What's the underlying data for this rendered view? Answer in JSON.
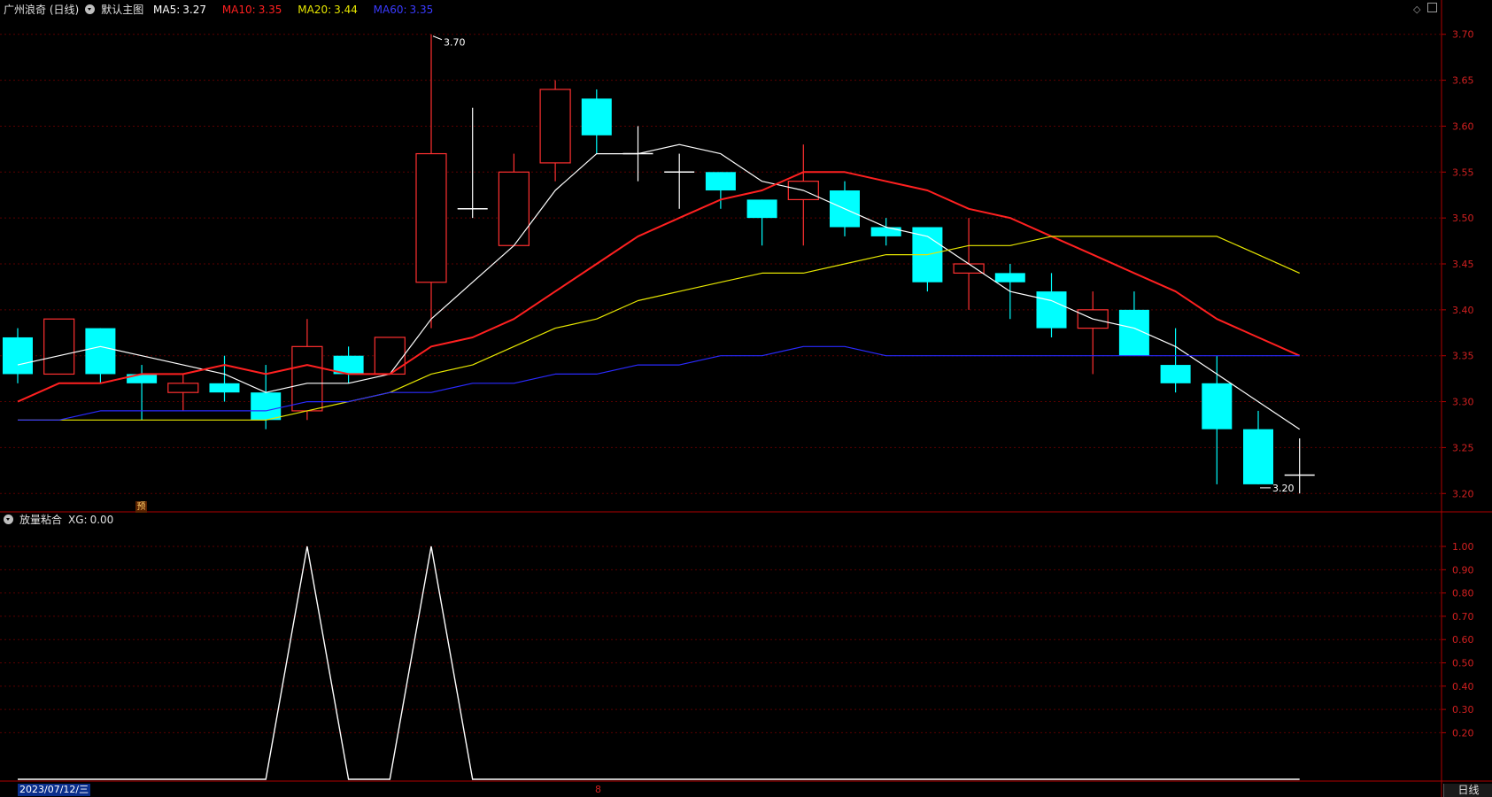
{
  "header": {
    "stock_name": "广州浪奇 (日线)",
    "main_chart_label": "默认主图",
    "ma5": {
      "label": "MA5:",
      "value": "3.27",
      "color": "#ffffff"
    },
    "ma10": {
      "label": "MA10:",
      "value": "3.35",
      "color": "#ff2020"
    },
    "ma20": {
      "label": "MA20:",
      "value": "3.44",
      "color": "#e6e600"
    },
    "ma60": {
      "label": "MA60:",
      "value": "3.35",
      "color": "#2a2aff"
    }
  },
  "indicator_header": {
    "name": "放量粘合",
    "xg_label": "XG:",
    "xg_value": "0.00"
  },
  "footer": {
    "date": "2023/07/12/三",
    "month_marker": "8",
    "period_tab": "日线"
  },
  "badge": {
    "text": "预"
  },
  "annotations": {
    "high": "3.70",
    "low": "3.20"
  },
  "colors": {
    "up": "#ff3030",
    "down": "#00ffff",
    "grid": "#5a0000",
    "axis": "#b00000",
    "axis_text": "#d02020"
  },
  "chart_data": [
    {
      "type": "candlestick",
      "ylim": [
        3.18,
        3.72
      ],
      "y_ticks": [
        "3.20",
        "3.25",
        "3.30",
        "3.35",
        "3.40",
        "3.45",
        "3.50",
        "3.55",
        "3.60",
        "3.65",
        "3.70"
      ],
      "grid": true,
      "candles": [
        {
          "o": 3.37,
          "h": 3.38,
          "l": 3.32,
          "c": 3.33
        },
        {
          "o": 3.33,
          "h": 3.39,
          "l": 3.33,
          "c": 3.39
        },
        {
          "o": 3.38,
          "h": 3.38,
          "l": 3.32,
          "c": 3.33
        },
        {
          "o": 3.33,
          "h": 3.34,
          "l": 3.28,
          "c": 3.32
        },
        {
          "o": 3.31,
          "h": 3.33,
          "l": 3.29,
          "c": 3.32
        },
        {
          "o": 3.32,
          "h": 3.35,
          "l": 3.3,
          "c": 3.31
        },
        {
          "o": 3.31,
          "h": 3.34,
          "l": 3.27,
          "c": 3.28
        },
        {
          "o": 3.29,
          "h": 3.39,
          "l": 3.28,
          "c": 3.36
        },
        {
          "o": 3.35,
          "h": 3.36,
          "l": 3.32,
          "c": 3.33
        },
        {
          "o": 3.33,
          "h": 3.37,
          "l": 3.33,
          "c": 3.37
        },
        {
          "o": 3.43,
          "h": 3.7,
          "l": 3.38,
          "c": 3.57
        },
        {
          "o": 3.51,
          "h": 3.62,
          "l": 3.5,
          "c": 3.51
        },
        {
          "o": 3.47,
          "h": 3.57,
          "l": 3.47,
          "c": 3.55
        },
        {
          "o": 3.56,
          "h": 3.65,
          "l": 3.54,
          "c": 3.64
        },
        {
          "o": 3.63,
          "h": 3.64,
          "l": 3.57,
          "c": 3.59
        },
        {
          "o": 3.57,
          "h": 3.6,
          "l": 3.54,
          "c": 3.57
        },
        {
          "o": 3.55,
          "h": 3.57,
          "l": 3.51,
          "c": 3.55
        },
        {
          "o": 3.55,
          "h": 3.55,
          "l": 3.51,
          "c": 3.53
        },
        {
          "o": 3.52,
          "h": 3.52,
          "l": 3.47,
          "c": 3.5
        },
        {
          "o": 3.52,
          "h": 3.58,
          "l": 3.47,
          "c": 3.54
        },
        {
          "o": 3.53,
          "h": 3.54,
          "l": 3.48,
          "c": 3.49
        },
        {
          "o": 3.49,
          "h": 3.5,
          "l": 3.47,
          "c": 3.48
        },
        {
          "o": 3.49,
          "h": 3.49,
          "l": 3.42,
          "c": 3.43
        },
        {
          "o": 3.44,
          "h": 3.5,
          "l": 3.4,
          "c": 3.45
        },
        {
          "o": 3.44,
          "h": 3.45,
          "l": 3.39,
          "c": 3.43
        },
        {
          "o": 3.42,
          "h": 3.44,
          "l": 3.37,
          "c": 3.38
        },
        {
          "o": 3.38,
          "h": 3.42,
          "l": 3.33,
          "c": 3.4
        },
        {
          "o": 3.4,
          "h": 3.42,
          "l": 3.35,
          "c": 3.35
        },
        {
          "o": 3.34,
          "h": 3.38,
          "l": 3.31,
          "c": 3.32
        },
        {
          "o": 3.32,
          "h": 3.35,
          "l": 3.21,
          "c": 3.27
        },
        {
          "o": 3.27,
          "h": 3.29,
          "l": 3.21,
          "c": 3.21
        },
        {
          "o": 3.22,
          "h": 3.26,
          "l": 3.2,
          "c": 3.22
        }
      ],
      "series": [
        {
          "name": "MA5",
          "color": "#ffffff",
          "values": [
            3.34,
            3.35,
            3.36,
            3.35,
            3.34,
            3.33,
            3.31,
            3.32,
            3.32,
            3.33,
            3.39,
            3.43,
            3.47,
            3.53,
            3.57,
            3.57,
            3.58,
            3.57,
            3.54,
            3.53,
            3.51,
            3.49,
            3.48,
            3.45,
            3.42,
            3.41,
            3.39,
            3.38,
            3.36,
            3.33,
            3.3,
            3.27
          ]
        },
        {
          "name": "MA10",
          "color": "#ff2020",
          "values": [
            3.3,
            3.32,
            3.32,
            3.33,
            3.33,
            3.34,
            3.33,
            3.34,
            3.33,
            3.33,
            3.36,
            3.37,
            3.39,
            3.42,
            3.45,
            3.48,
            3.5,
            3.52,
            3.53,
            3.55,
            3.55,
            3.54,
            3.53,
            3.51,
            3.5,
            3.48,
            3.46,
            3.44,
            3.42,
            3.39,
            3.37,
            3.35
          ]
        },
        {
          "name": "MA20",
          "color": "#e6e600",
          "values": [
            3.28,
            3.28,
            3.28,
            3.28,
            3.28,
            3.28,
            3.28,
            3.29,
            3.3,
            3.31,
            3.33,
            3.34,
            3.36,
            3.38,
            3.39,
            3.41,
            3.42,
            3.43,
            3.44,
            3.44,
            3.45,
            3.46,
            3.46,
            3.47,
            3.47,
            3.48,
            3.48,
            3.48,
            3.48,
            3.48,
            3.46,
            3.44
          ]
        },
        {
          "name": "MA60",
          "color": "#2a2aff",
          "values": [
            3.28,
            3.28,
            3.29,
            3.29,
            3.29,
            3.29,
            3.29,
            3.3,
            3.3,
            3.31,
            3.31,
            3.32,
            3.32,
            3.33,
            3.33,
            3.34,
            3.34,
            3.35,
            3.35,
            3.36,
            3.36,
            3.35,
            3.35,
            3.35,
            3.35,
            3.35,
            3.35,
            3.35,
            3.35,
            3.35,
            3.35,
            3.35
          ]
        }
      ]
    },
    {
      "type": "line",
      "ylim": [
        0.0,
        1.08
      ],
      "y_ticks": [
        "0.20",
        "0.30",
        "0.40",
        "0.50",
        "0.60",
        "0.70",
        "0.80",
        "0.90",
        "1.00"
      ],
      "grid": true,
      "series": [
        {
          "name": "XG",
          "color": "#ffffff",
          "values": [
            0,
            0,
            0,
            0,
            0,
            0,
            0,
            1,
            0,
            0,
            1,
            0,
            0,
            0,
            0,
            0,
            0,
            0,
            0,
            0,
            0,
            0,
            0,
            0,
            0,
            0,
            0,
            0,
            0,
            0,
            0,
            0
          ]
        }
      ]
    }
  ]
}
